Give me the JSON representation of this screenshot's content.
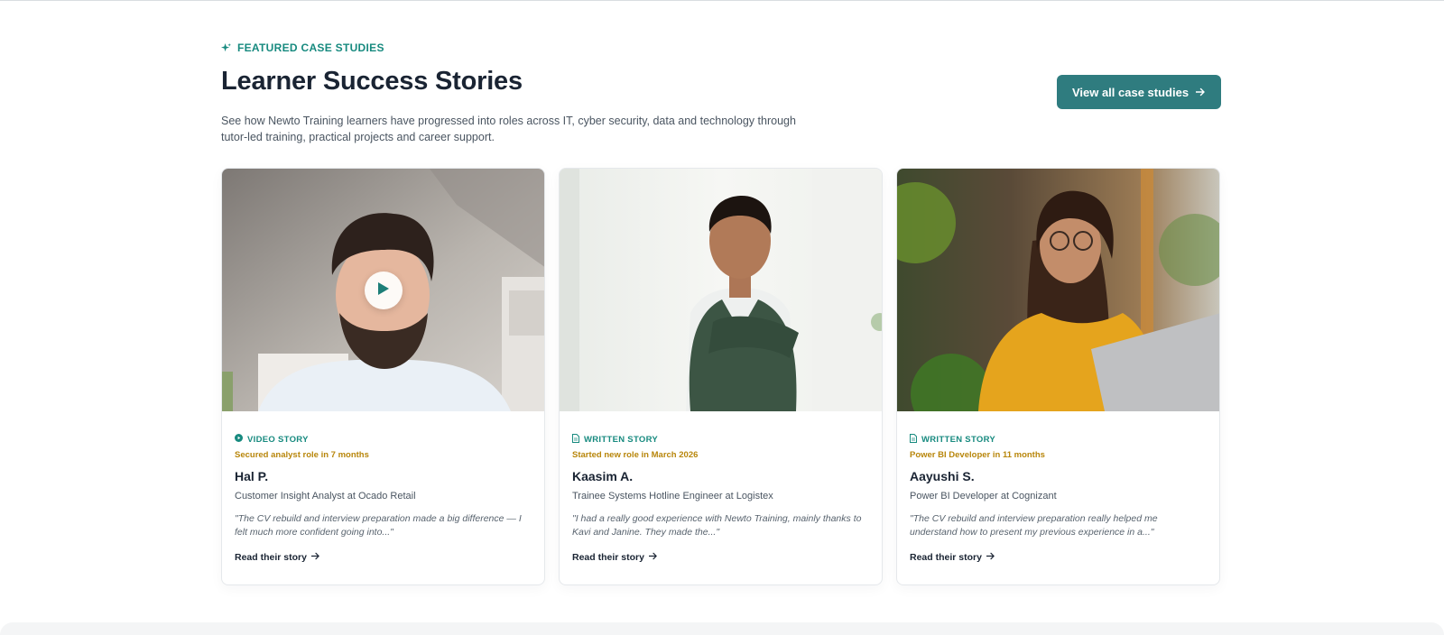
{
  "section": {
    "eyebrow": "FEATURED CASE STUDIES",
    "title": "Learner Success Stories",
    "intro": "See how Newto Training learners have progressed into roles across IT, cyber security, data and technology through tutor-led training, practical projects and career support.",
    "cta_label": "View all case studies"
  },
  "colors": {
    "accent": "#178a7f",
    "button": "#2f7c7f",
    "milestone": "#b8860b",
    "heading": "#1a2433"
  },
  "cards": [
    {
      "type_label": "VIDEO STORY",
      "type_icon": "play-circle-icon",
      "milestone": "Secured analyst role in 7 months",
      "name": "Hal P.",
      "role": "Customer Insight Analyst at Ocado Retail",
      "quote": "\"The CV rebuild and interview preparation made a big difference — I felt much more confident going into...\"",
      "link": "Read their story"
    },
    {
      "type_label": "WRITTEN STORY",
      "type_icon": "document-icon",
      "milestone": "Started new role in March 2026",
      "name": "Kaasim A.",
      "role": "Trainee Systems Hotline Engineer at Logistex",
      "quote": "\"I had a really good experience with Newto Training, mainly thanks to Kavi and Janine. They made the...\"",
      "link": "Read their story"
    },
    {
      "type_label": "WRITTEN STORY",
      "type_icon": "document-icon",
      "milestone": "Power BI Developer in 11 months",
      "name": "Aayushi S.",
      "role": "Power BI Developer at Cognizant",
      "quote": "\"The CV rebuild and interview preparation really helped me understand how to present my previous experience in a...\"",
      "link": "Read their story"
    }
  ]
}
